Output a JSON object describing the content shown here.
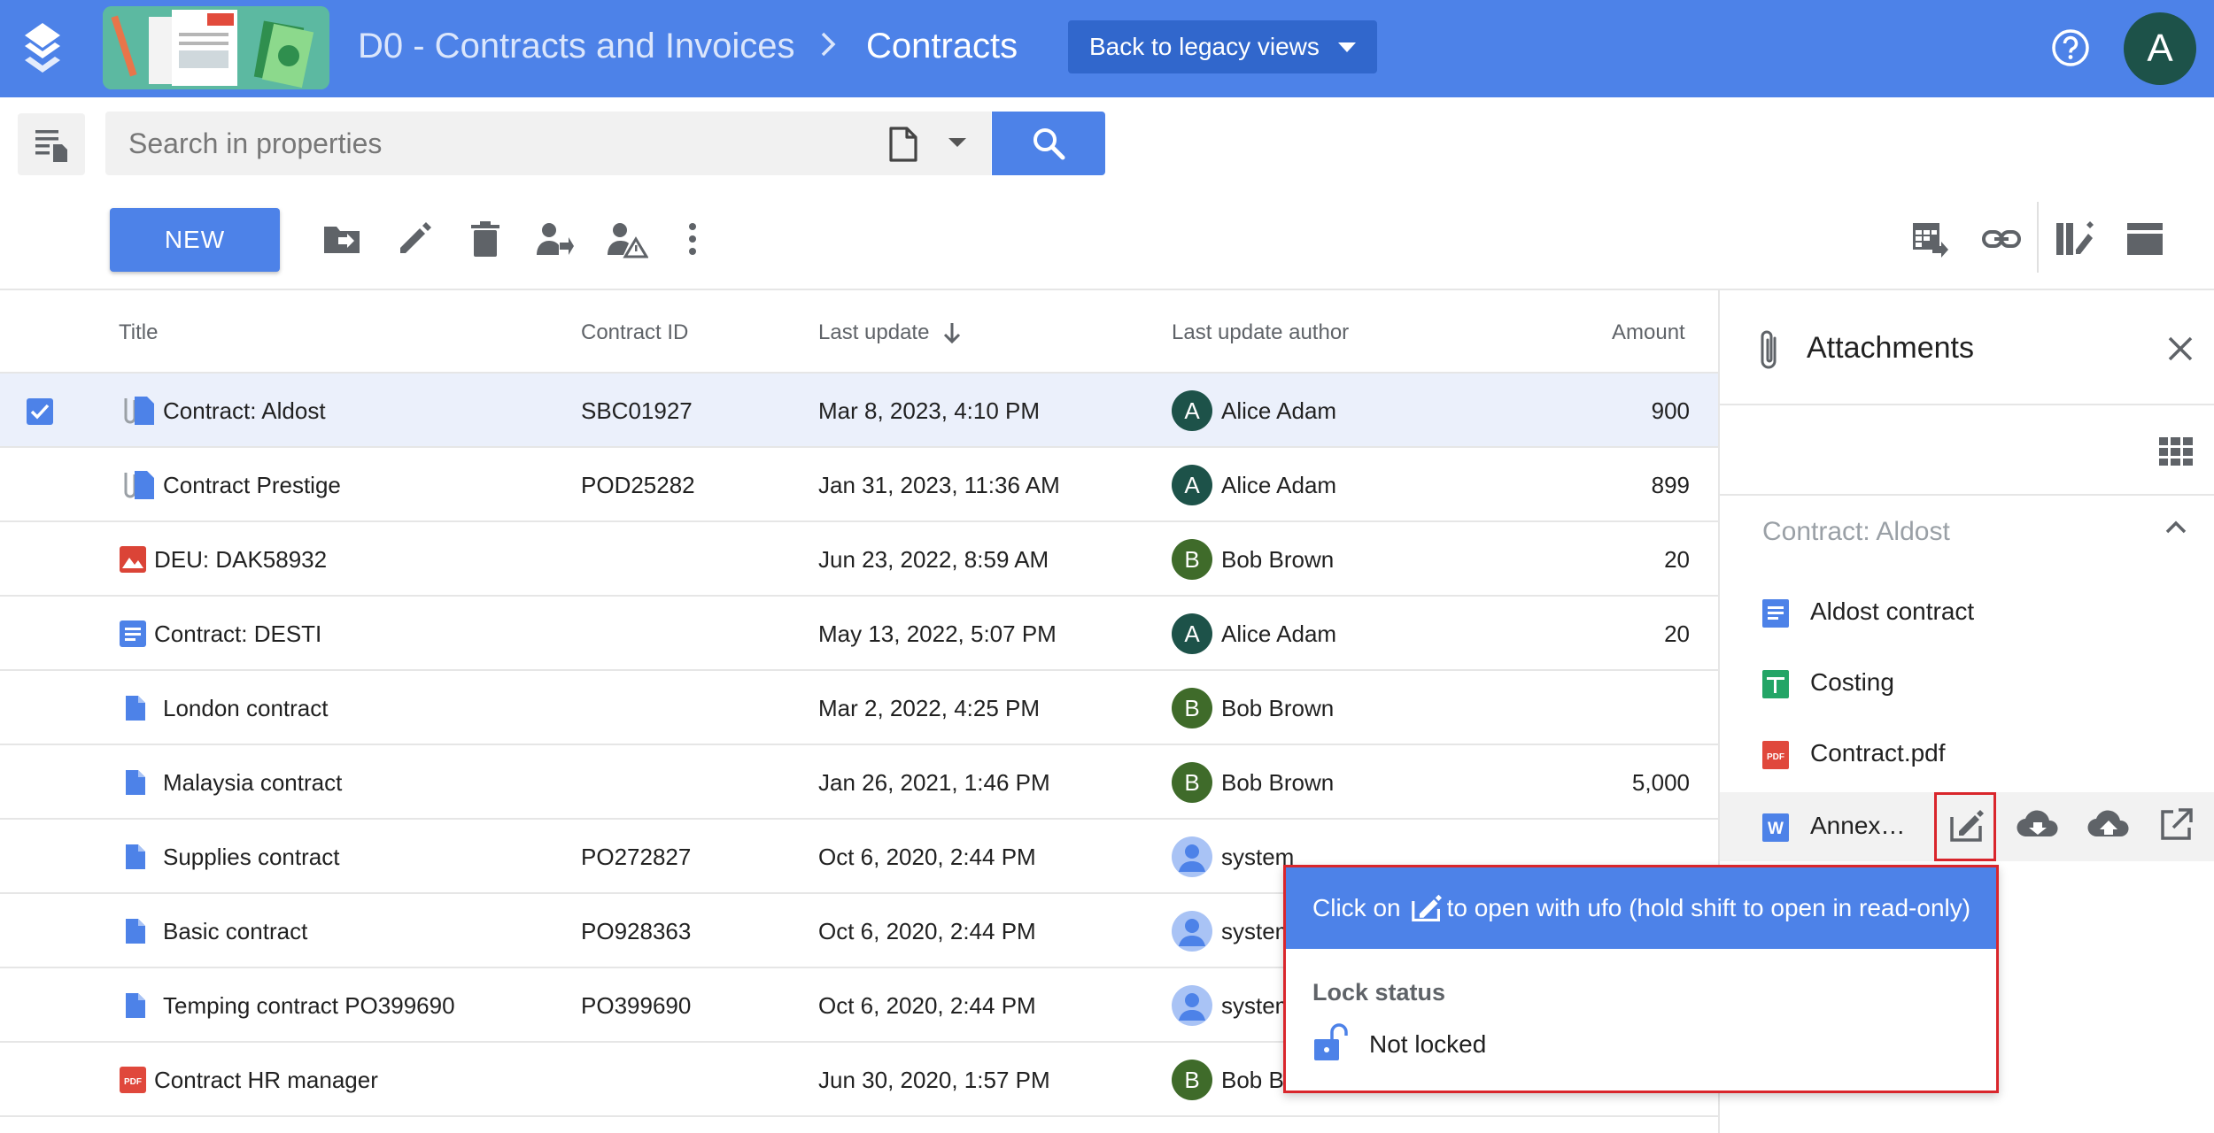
{
  "header": {
    "breadcrumb_space": "D0 - Contracts and Invoices",
    "breadcrumb_current": "Contracts",
    "legacy_button_label": "Back to legacy views",
    "user_initial": "A",
    "accent_color": "#4d82e8"
  },
  "search": {
    "placeholder": "Search in properties",
    "doc_type_icon": "document-icon"
  },
  "toolbar": {
    "new_label": "NEW",
    "icons": [
      "move-to-folder-icon",
      "edit-icon",
      "delete-icon",
      "assign-user-icon",
      "manage-permissions-icon",
      "more-vert-icon",
      "export-table-icon",
      "link-icon",
      "edit-columns-icon",
      "panel-view-icon"
    ]
  },
  "table": {
    "columns": [
      "Title",
      "Contract ID",
      "Last update",
      "Last update author",
      "Amount"
    ],
    "rows": [
      {
        "icon": "attached-doc-icon",
        "title": "Contract: Aldost",
        "contract_id": "SBC01927",
        "last_update": "Mar 8, 2023, 4:10 PM",
        "author_initial": "A",
        "author": "Alice Adam",
        "amount": "900",
        "selected": true
      },
      {
        "icon": "attached-doc-icon",
        "title": "Contract Prestige",
        "contract_id": "POD25282",
        "last_update": "Jan 31, 2023, 11:36 AM",
        "author_initial": "A",
        "author": "Alice Adam",
        "amount": "899"
      },
      {
        "icon": "image-file-icon",
        "title": "DEU: DAK58932",
        "contract_id": "",
        "last_update": "Jun 23, 2022, 8:59 AM",
        "author_initial": "B",
        "author": "Bob Brown",
        "amount": "20"
      },
      {
        "icon": "text-doc-icon",
        "title": "Contract: DESTI",
        "contract_id": "",
        "last_update": "May 13, 2022, 5:07 PM",
        "author_initial": "A",
        "author": "Alice Adam",
        "amount": "20"
      },
      {
        "icon": "file-icon",
        "title": "London contract",
        "contract_id": "",
        "last_update": "Mar 2, 2022, 4:25 PM",
        "author_initial": "B",
        "author": "Bob Brown",
        "amount": ""
      },
      {
        "icon": "file-icon",
        "title": "Malaysia contract",
        "contract_id": "",
        "last_update": "Jan 26, 2021, 1:46 PM",
        "author_initial": "B",
        "author": "Bob Brown",
        "amount": "5,000"
      },
      {
        "icon": "file-icon",
        "title": "Supplies contract",
        "contract_id": "PO272827",
        "last_update": "Oct 6, 2020, 2:44 PM",
        "author_initial": "",
        "author": "system",
        "amount": ""
      },
      {
        "icon": "file-icon",
        "title": "Basic contract",
        "contract_id": "PO928363",
        "last_update": "Oct 6, 2020, 2:44 PM",
        "author_initial": "",
        "author": "system",
        "amount": ""
      },
      {
        "icon": "file-icon",
        "title": "Temping contract PO399690",
        "contract_id": "PO399690",
        "last_update": "Oct 6, 2020, 2:44 PM",
        "author_initial": "",
        "author": "system",
        "amount": ""
      },
      {
        "icon": "pdf-icon",
        "title": "Contract HR manager",
        "contract_id": "",
        "last_update": "Jun 30, 2020, 1:57 PM",
        "author_initial": "B",
        "author": "Bob Brown",
        "amount": ""
      }
    ]
  },
  "panel": {
    "title": "Attachments",
    "document_title": "Contract: Aldost",
    "attachments": [
      {
        "icon": "google-doc-icon",
        "label": "Aldost contract"
      },
      {
        "icon": "google-sheet-icon",
        "label": "Costing"
      },
      {
        "icon": "pdf-icon",
        "label": "Contract.pdf"
      },
      {
        "icon": "word-doc-icon",
        "label": "Annex…"
      }
    ]
  },
  "popup": {
    "hint_before": "Click on",
    "hint_after": "to open with ufo (hold shift to open in read-only)",
    "lock_title": "Lock status",
    "lock_value": "Not locked"
  }
}
